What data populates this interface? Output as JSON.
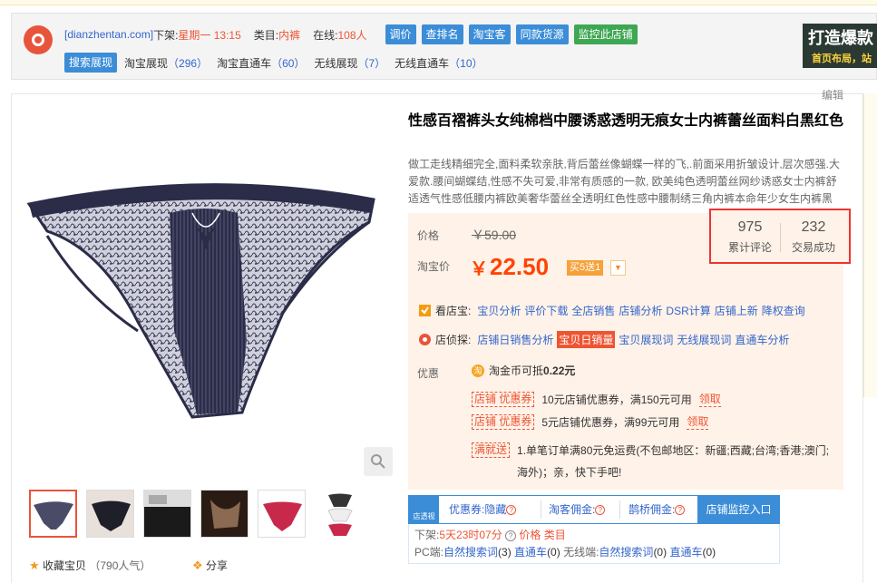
{
  "plugin": {
    "domain": "[dianzhentan.com]",
    "listed_label": "下架:",
    "listed_value": "星期一 13:15",
    "category_label": "类目:",
    "category_value": "内裤",
    "online_label": "在线:",
    "online_value": "108人",
    "buttons": [
      "调价",
      "查排名",
      "淘宝客",
      "同款货源"
    ],
    "monitor_button": "监控此店铺",
    "tabs": [
      {
        "label": "搜索展现",
        "count": ""
      },
      {
        "label": "淘宝展现",
        "count": "（296）"
      },
      {
        "label": "淘宝直通车",
        "count": "（60）"
      },
      {
        "label": "无线展现",
        "count": "（7）"
      },
      {
        "label": "无线直通车",
        "count": "（10）"
      }
    ],
    "banner_line1": "打造爆款",
    "banner_line2": "首页布局，站"
  },
  "edit_label": "编辑",
  "product": {
    "title": "性感百褶裤头女纯棉档中腰诱惑透明无痕女士内裤蕾丝面料白黑红色",
    "subtitle": "做工走线精细完全,面料柔软亲肤,背后蕾丝像蝴蝶一样的飞,.前面采用折皱设计,层次感强.大爱款.腰间蝴蝶结,性感不失可爱,非常有质感的一款, 欧美纯色透明蕾丝网纱诱惑女士内裤舒适透气性感低腰内裤欧美奢华蕾丝全透明红色性感中腰制绣三角内裤本命年少女生内裤黑",
    "price_label": "价格",
    "old_price": "￥59.00",
    "tb_price_label": "淘宝价",
    "currency": "￥",
    "new_price": "22.50",
    "promo_tag": "买5送1",
    "reviews_count": "975",
    "reviews_label": "累计评论",
    "sales_count": "232",
    "sales_label": "交易成功"
  },
  "tools": {
    "row1_label": "看店宝:",
    "row1_links": [
      "宝贝分析",
      "评价下载",
      "全店销售",
      "店铺分析",
      "DSR计算",
      "店铺上新",
      "降权查询"
    ],
    "row2_label": "店侦探:",
    "row2_links": [
      "店铺日销售分析",
      "宝贝日销量",
      "宝贝展现词",
      "无线展现词",
      "直通车分析"
    ]
  },
  "benefits": {
    "label": "优惠",
    "coin_icon": "淘",
    "coin_text": "淘金币可抵",
    "coin_amount": "0.22元",
    "coupons": [
      {
        "tag": "店铺 优惠券",
        "text": "10元店铺优惠券，满150元可用",
        "get": "领取"
      },
      {
        "tag": "店铺 优惠券",
        "text": "5元店铺优惠券，满99元可用",
        "get": "领取"
      }
    ],
    "mjs_tag": "满就送",
    "mjs_text": "1.单笔订单满80元免运费(不包邮地区：新疆;西藏;台湾;香港;澳门;海外)；亲，快下手吧!"
  },
  "monitor": {
    "logo_text": "店透视",
    "cells": [
      "优惠券:隐藏",
      "淘客佣金:",
      "鹊桥佣金:"
    ],
    "entry_button": "店铺监控入口",
    "delist_label": "下架:",
    "delist_value": "5天23时07分",
    "price_link": "价格",
    "category_link": "类目",
    "pc_label": "PC端:",
    "pc_search": "自然搜索词",
    "pc_search_n": "(3)",
    "pc_ztc": "直通车",
    "pc_ztc_n": "(0)",
    "wl_label": "无线端:",
    "wl_search": "自然搜索词",
    "wl_search_n": "(0)",
    "wl_ztc": "直通车",
    "wl_ztc_n": "(0)"
  },
  "actions": {
    "collect_label": "收藏宝贝",
    "collect_count": "（790人气）",
    "share_label": "分享"
  },
  "colors": {
    "accent": "#ff4400",
    "blue": "#3c8dd8",
    "green": "#3ea752",
    "highlight": "#ee3333"
  }
}
